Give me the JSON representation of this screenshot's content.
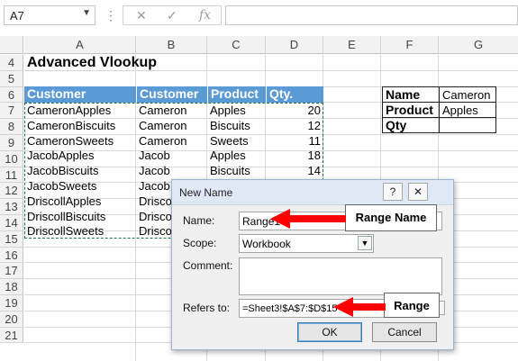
{
  "formula_bar": {
    "name_box": "A7",
    "cancel_icon": "✕",
    "enter_icon": "✓",
    "fx_label": "fx",
    "formula": ""
  },
  "columns": [
    "A",
    "B",
    "C",
    "D",
    "E",
    "F",
    "G"
  ],
  "rows": [
    "4",
    "5",
    "6",
    "7",
    "8",
    "9",
    "10",
    "11",
    "12",
    "13",
    "14",
    "15",
    "16",
    "17",
    "18",
    "19",
    "20",
    "21"
  ],
  "sheet": {
    "title": "Advanced Vlookup",
    "table_headers": [
      "Customer",
      "Customer",
      "Product",
      "Qty."
    ],
    "table_rows": [
      [
        "CameronApples",
        "Cameron",
        "Apples",
        "20"
      ],
      [
        "CameronBiscuits",
        "Cameron",
        "Biscuits",
        "12"
      ],
      [
        "CameronSweets",
        "Cameron",
        "Sweets",
        "11"
      ],
      [
        "JacobApples",
        "Jacob",
        "Apples",
        "18"
      ],
      [
        "JacobBiscuits",
        "Jacob",
        "Biscuits",
        "14"
      ],
      [
        "JacobSweets",
        "Jacob",
        "",
        ""
      ],
      [
        "DriscollApples",
        "Drisco",
        "",
        ""
      ],
      [
        "DriscollBiscuits",
        "Drisco",
        "",
        ""
      ],
      [
        "DriscollSweets",
        "Drisco",
        "",
        ""
      ]
    ],
    "lookup": [
      {
        "label": "Name",
        "value": "Cameron"
      },
      {
        "label": "Product",
        "value": "Apples"
      },
      {
        "label": "Qty",
        "value": ""
      }
    ]
  },
  "dialog": {
    "title": "New Name",
    "help_label": "?",
    "close_label": "✕",
    "name_label": "Name:",
    "name_value": "Range1",
    "scope_label": "Scope:",
    "scope_value": "Workbook",
    "comment_label": "Comment:",
    "comment_value": "",
    "refers_label": "Refers to:",
    "refers_value": "=Sheet3!$A$7:$D$15",
    "ok_label": "OK",
    "cancel_label": "Cancel"
  },
  "callouts": {
    "range_name": "Range Name",
    "range": "Range"
  },
  "colors": {
    "header_blue": "#5b9bd5",
    "selection_green": "#217346",
    "arrow_red": "#ff0000"
  }
}
